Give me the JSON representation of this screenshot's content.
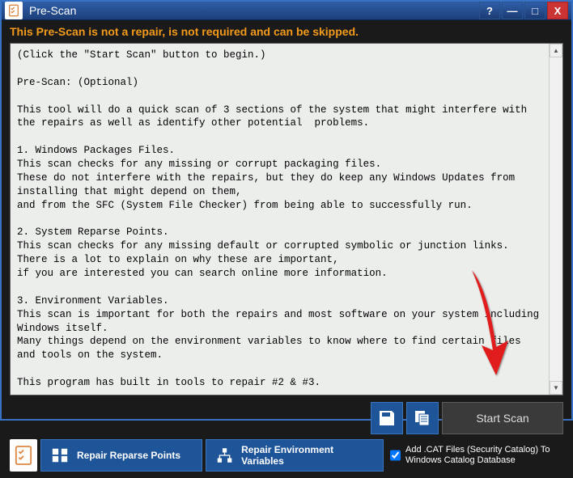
{
  "window": {
    "title": "Pre-Scan"
  },
  "titlebar_buttons": {
    "help": "?",
    "minimize": "—",
    "maximize": "□",
    "close": "X"
  },
  "warning": "This Pre-Scan is not a repair, is not required and can be skipped.",
  "scan_text": "(Click the \"Start Scan\" button to begin.)\n\nPre-Scan: (Optional)\n\nThis tool will do a quick scan of 3 sections of the system that might interfere with the repairs as well as identify other potential  problems.\n\n1. Windows Packages Files.\nThis scan checks for any missing or corrupt packaging files.\nThese do not interfere with the repairs, but they do keep any Windows Updates from installing that might depend on them,\nand from the SFC (System File Checker) from being able to successfully run.\n\n2. System Reparse Points.\nThis scan checks for any missing default or corrupted symbolic or junction links.\nThere is a lot to explain on why these are important,\nif you are interested you can search online more information.\n\n3. Environment Variables.\nThis scan is important for both the repairs and most software on your system including Windows itself.\nMany things depend on the environment variables to know where to find certain files and tools on the system.\n\nThis program has built in tools to repair #2 & #3.",
  "actions": {
    "save_icon": "save-icon",
    "copy_icon": "copy-icon",
    "start_scan": "Start Scan"
  },
  "bottom": {
    "repair_reparse": "Repair Reparse Points",
    "repair_env": "Repair Environment Variables",
    "add_cat_label": "Add .CAT Files (Security Catalog) To Windows Catalog Database",
    "add_cat_checked": true
  }
}
